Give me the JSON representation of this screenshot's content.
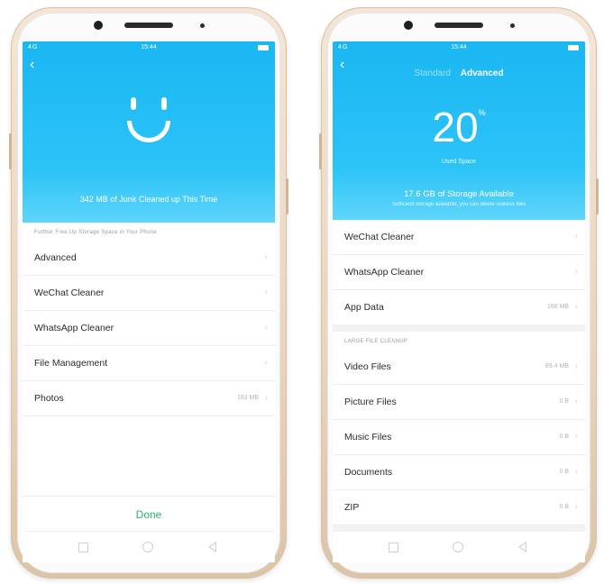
{
  "left_screen": {
    "status": {
      "signal": "4G",
      "time": "15:44"
    },
    "back_label": "‹",
    "junk_message": "342 MB of Junk Cleaned up This Time",
    "section_label": "Further Free Up Storage Space in Your Phone",
    "items": [
      {
        "label": "Advanced",
        "value": ""
      },
      {
        "label": "WeChat Cleaner",
        "value": ""
      },
      {
        "label": "WhatsApp Cleaner",
        "value": ""
      },
      {
        "label": "File Management",
        "value": ""
      },
      {
        "label": "Photos",
        "value": "183 MB"
      }
    ],
    "done_label": "Done"
  },
  "right_screen": {
    "status": {
      "signal": "4G",
      "time": "15:44"
    },
    "back_label": "‹",
    "tabs": {
      "standard": "Standard",
      "advanced": "Advanced"
    },
    "used_percent": "20",
    "percent_symbol": "%",
    "used_label": "Used Space",
    "available": "17.6 GB of Storage Available",
    "available_sub": "Sufficient storage available, you can delete useless files",
    "items_top": [
      {
        "label": "WeChat Cleaner",
        "value": ""
      },
      {
        "label": "WhatsApp Cleaner",
        "value": ""
      },
      {
        "label": "App Data",
        "value": "168 MB"
      }
    ],
    "large_section_label": "LARGE FILE CLEANUP",
    "items_large": [
      {
        "label": "Video Files",
        "value": "89.4 MB"
      },
      {
        "label": "Picture Files",
        "value": "0 B"
      },
      {
        "label": "Music Files",
        "value": "0 B"
      },
      {
        "label": "Documents",
        "value": "0 B"
      },
      {
        "label": "ZIP",
        "value": "0 B"
      }
    ]
  },
  "icons": {
    "chevron": "chevron-right-icon",
    "nav": [
      "recents-square-icon",
      "home-circle-icon",
      "back-triangle-icon"
    ]
  },
  "colors": {
    "header_blue": "#1bb7f3",
    "done_green": "#27b46b",
    "phone_gold": "#e9d5bd"
  }
}
